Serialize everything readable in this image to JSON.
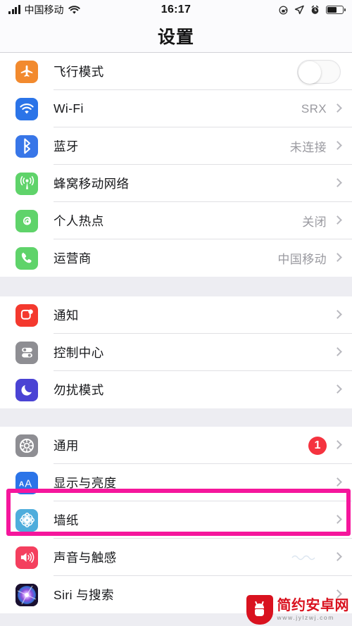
{
  "status_bar": {
    "carrier": "中国移动",
    "time": "16:17",
    "icons": [
      "signal-bars-icon",
      "wifi-icon",
      "rotation-lock-icon",
      "location-arrow-icon",
      "alarm-clock-icon",
      "battery-icon"
    ],
    "battery_level_pct": 62
  },
  "header": {
    "title": "设置"
  },
  "colors": {
    "highlight": "#f5169c",
    "badge": "#f5333f",
    "airplane": "#f28a2e",
    "wifi": "#2b74e8",
    "bluetooth": "#3876e8",
    "cellular": "#5fd36a",
    "hotspot": "#5fd36a",
    "carrier": "#5fd36a",
    "notifications": "#f4392e",
    "control_center": "#8e8e93",
    "dnd": "#4a43d4",
    "general": "#8e8e93",
    "display": "#2b74e8",
    "wallpaper": "#4eaddc",
    "sounds": "#f43f5e",
    "siri": "#2b1a4d"
  },
  "sections": [
    {
      "id": "connectivity",
      "rows": [
        {
          "label": "飞行模式",
          "icon": "airplane-icon",
          "icon_color": "#f28a2e",
          "accessory": "toggle",
          "toggle_on": false,
          "value": ""
        },
        {
          "label": "Wi-Fi",
          "icon": "wifi-icon",
          "icon_color": "#2b74e8",
          "accessory": "chevron",
          "value": "SRX"
        },
        {
          "label": "蓝牙",
          "icon": "bluetooth-icon",
          "icon_color": "#3876e8",
          "accessory": "chevron",
          "value": "未连接"
        },
        {
          "label": "蜂窝移动网络",
          "icon": "cellular-antenna-icon",
          "icon_color": "#5fd36a",
          "accessory": "chevron",
          "value": ""
        },
        {
          "label": "个人热点",
          "icon": "hotspot-link-icon",
          "icon_color": "#5fd36a",
          "accessory": "chevron",
          "value": "关闭"
        },
        {
          "label": "运营商",
          "icon": "phone-handset-icon",
          "icon_color": "#5fd36a",
          "accessory": "chevron",
          "value": "中国移动"
        }
      ]
    },
    {
      "id": "alerts",
      "rows": [
        {
          "label": "通知",
          "icon": "notification-badge-icon",
          "icon_color": "#f4392e",
          "accessory": "chevron",
          "value": ""
        },
        {
          "label": "控制中心",
          "icon": "control-center-toggles-icon",
          "icon_color": "#8e8e93",
          "accessory": "chevron",
          "value": ""
        },
        {
          "label": "勿扰模式",
          "icon": "moon-crescent-icon",
          "icon_color": "#4a43d4",
          "accessory": "chevron",
          "value": ""
        }
      ]
    },
    {
      "id": "system",
      "rows": [
        {
          "label": "通用",
          "icon": "gear-icon",
          "icon_color": "#8e8e93",
          "accessory": "badge",
          "badge": "1",
          "value": ""
        },
        {
          "label": "显示与亮度",
          "icon": "display-aa-icon",
          "icon_color": "#2b74e8",
          "accessory": "chevron",
          "value": "",
          "highlighted": true
        },
        {
          "label": "墙纸",
          "icon": "wallpaper-flower-icon",
          "icon_color": "#4eaddc",
          "accessory": "chevron",
          "value": ""
        },
        {
          "label": "声音与触感",
          "icon": "speaker-volume-icon",
          "icon_color": "#f43f5e",
          "accessory": "chevron",
          "value": ""
        },
        {
          "label": "Siri 与搜索",
          "icon": "siri-orb-icon",
          "icon_color": "#2b1a4d",
          "accessory": "chevron",
          "value": ""
        }
      ]
    }
  ],
  "watermark": {
    "name": "简约安卓网",
    "url": "www.jylzwj.com",
    "logo": "android-shield-icon"
  }
}
